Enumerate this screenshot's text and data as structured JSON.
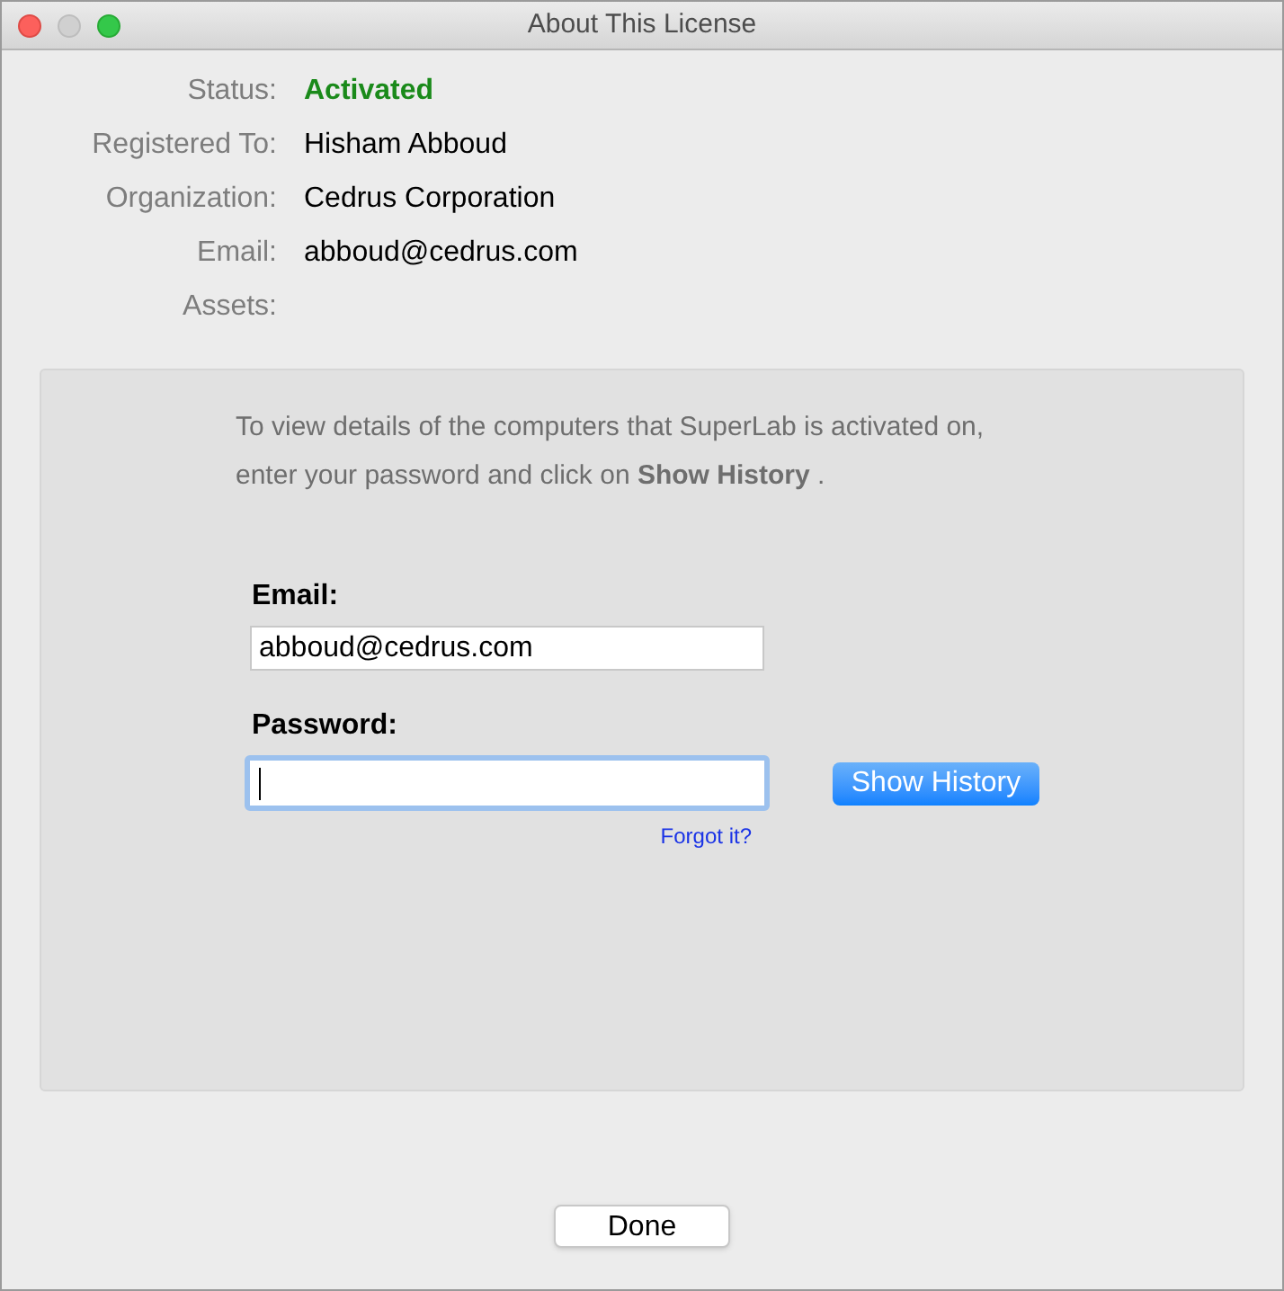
{
  "window": {
    "title": "About This License"
  },
  "info": [
    {
      "label": "Status:",
      "value": "Activated",
      "kind": "status"
    },
    {
      "label": "Registered To:",
      "value": "Hisham Abboud",
      "kind": "text"
    },
    {
      "label": "Organization:",
      "value": "Cedrus Corporation",
      "kind": "text"
    },
    {
      "label": "Email:",
      "value": "abboud@cedrus.com",
      "kind": "text"
    },
    {
      "label": "Assets:"
    }
  ],
  "panel": {
    "instructions": [
      "To view details of the computers that SuperLab is activated on,",
      "enter your password and click on **Show History** ."
    ],
    "fields": [
      {
        "label": "Email:",
        "value": "abboud@cedrus.com",
        "focused": false
      },
      {
        "label": "Password:",
        "focused": true
      }
    ],
    "show_history_button": "Show History",
    "forgot_link": "Forgot it?"
  },
  "done_button": "Done"
}
